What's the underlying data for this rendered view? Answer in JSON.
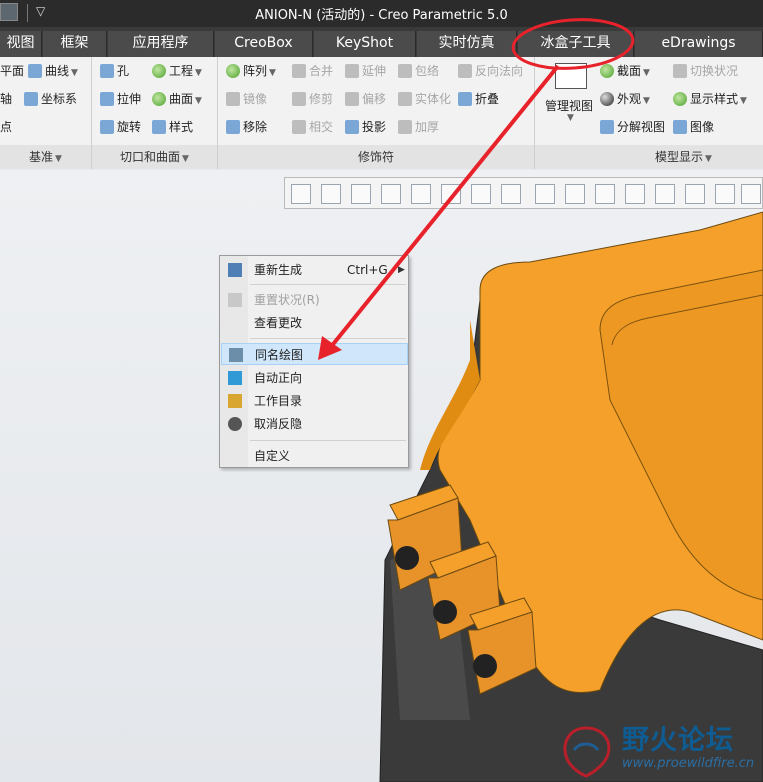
{
  "titlebar": {
    "title": "ANION-N (活动的) - Creo Parametric 5.0"
  },
  "tabs": [
    "视图",
    "框架",
    "应用程序",
    "CreoBox",
    "KeyShot",
    "实时仿真",
    "冰盒子工具",
    "eDrawings"
  ],
  "ribbon": {
    "groups": [
      "基准",
      "切口和曲面",
      "修饰符",
      "模型显示"
    ],
    "datum": {
      "items": [
        "平面",
        "曲线",
        "轴",
        "坐标系",
        "点"
      ]
    },
    "cuts": {
      "items": [
        "孔",
        "工程",
        "拉伸",
        "曲面",
        "旋转",
        "样式"
      ]
    },
    "modifiers": {
      "items": [
        "阵列",
        "合并",
        "延伸",
        "包络",
        "反向法向",
        "镜像",
        "修剪",
        "偏移",
        "实体化",
        "折叠",
        "移除",
        "相交",
        "投影",
        "加厚"
      ]
    },
    "display": {
      "items": [
        "管理视图",
        "截面",
        "切换状况",
        "外观",
        "显示样式",
        "分解视图",
        "图像"
      ]
    }
  },
  "context_menu": {
    "items": [
      {
        "label": "重新生成",
        "shortcut": "Ctrl+G"
      },
      {
        "label": "重置状况(R)"
      },
      {
        "label": "查看更改"
      },
      {
        "label": "同名绘图"
      },
      {
        "label": "自动正向"
      },
      {
        "label": "工作目录"
      },
      {
        "label": "取消反隐"
      },
      {
        "label": "自定义"
      }
    ]
  },
  "watermark": {
    "name": "野火论坛",
    "url": "www.proewildfire.cn"
  },
  "colors": {
    "annotation": "#e8222a",
    "model": "#f5a623",
    "highlight": "#cfe6fb"
  }
}
